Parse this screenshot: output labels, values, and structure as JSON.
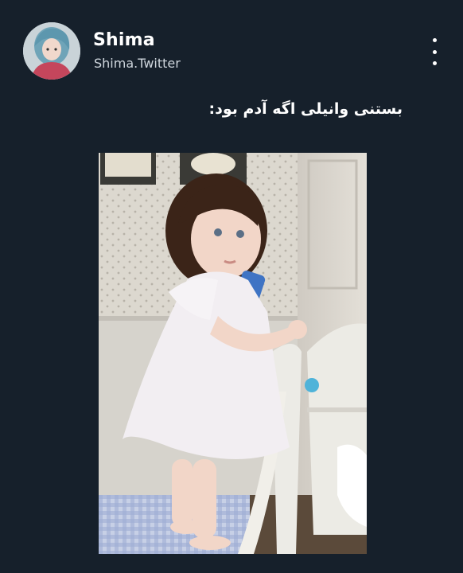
{
  "tweet": {
    "author": {
      "display_name": "Shima",
      "handle": "Shima.Twitter",
      "avatar_icon": "user-avatar"
    },
    "text": "بستنی وانیلی اگه آدم بود:",
    "menu_icon": "more-vertical-icon"
  },
  "colors": {
    "background": "#16202b",
    "text_primary": "#ffffff",
    "text_secondary": "#cfd6dd"
  }
}
